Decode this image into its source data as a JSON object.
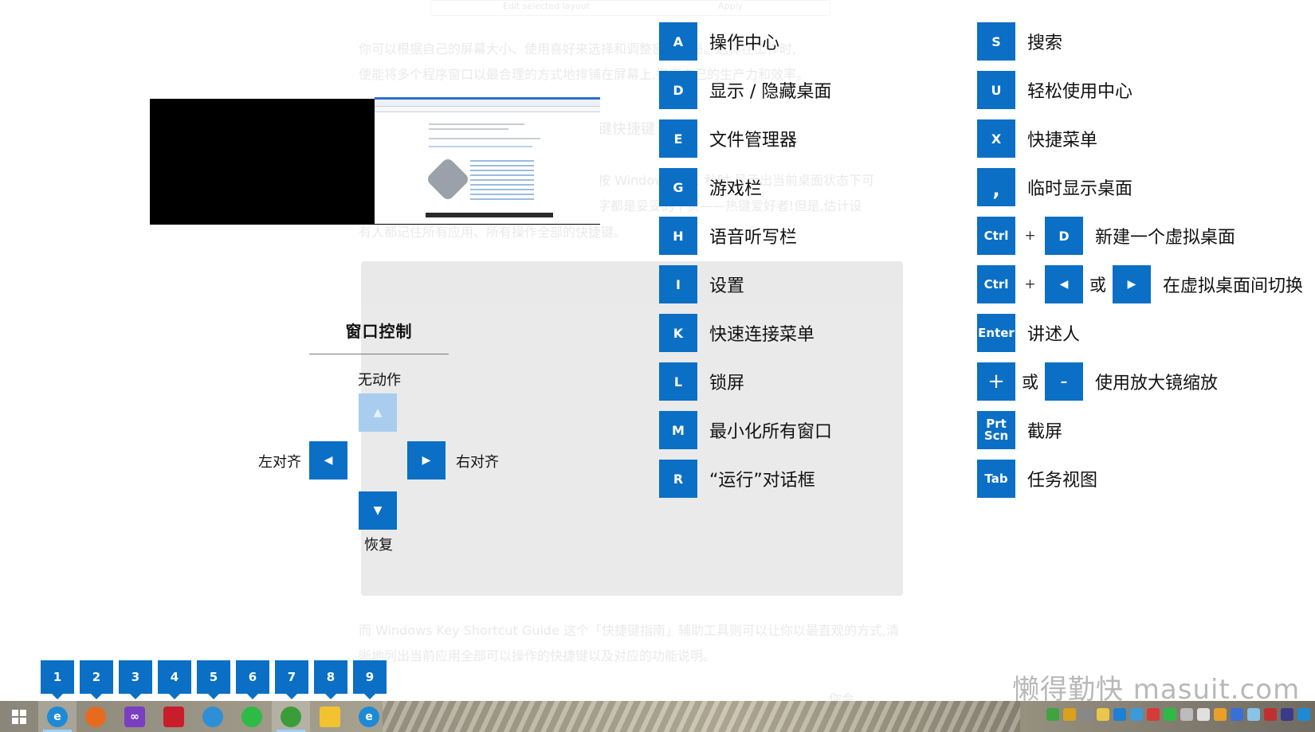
{
  "background_article": {
    "strip_labels": [
      "Edit selected layout",
      "Apply"
    ],
    "lines": [
      "你可以根据自己的屏幕大小、使用喜好来选择和调整窗口布局。这样在工作时,",
      "便能将多个程序窗口以最合理的方式地排铺在屏幕上,提高自己的生产力和效率。",
      "键快捷键",
      "按 Windows 键 1 秒时,显示出当前桌面状态下可",
      "字都是妥妥的干货——热键爱好者!但是,估计设",
      "有人都记住所有应用、所有操作全部的快捷键。",
      "而 Windows Key Shortcut Guide 这个「快捷键指南」辅助工具则可以让你以最直观的方式,清",
      "晰地列出当前应用全部可以操作的快捷键以及对应的功能说明。",
      "你会"
    ]
  },
  "window_controls": {
    "title": "窗口控制",
    "up_label": "无动作",
    "left_label": "左对齐",
    "right_label": "右对齐",
    "down_label": "恢复",
    "up_arrow": "▲",
    "left_arrow": "◀",
    "right_arrow": "▶",
    "down_arrow": "▼"
  },
  "shortcuts_left": [
    {
      "key": "A",
      "desc": "操作中心"
    },
    {
      "key": "D",
      "desc": "显示 / 隐藏桌面"
    },
    {
      "key": "E",
      "desc": "文件管理器"
    },
    {
      "key": "G",
      "desc": "游戏栏"
    },
    {
      "key": "H",
      "desc": "语音听写栏"
    },
    {
      "key": "I",
      "desc": "设置"
    },
    {
      "key": "K",
      "desc": "快速连接菜单"
    },
    {
      "key": "L",
      "desc": "锁屏"
    },
    {
      "key": "M",
      "desc": "最小化所有窗口"
    },
    {
      "key": "R",
      "desc": "“运行”对话框"
    }
  ],
  "shortcuts_right": {
    "s": {
      "key": "S",
      "desc": "搜索"
    },
    "u": {
      "key": "U",
      "desc": "轻松使用中心"
    },
    "x": {
      "key": "X",
      "desc": "快捷菜单"
    },
    "comma": {
      "key": ",",
      "desc": "临时显示桌面"
    },
    "ctrl_d": {
      "key1": "Ctrl",
      "plus": "+",
      "key2": "D",
      "desc": "新建一个虚拟桌面"
    },
    "ctrl_arrows": {
      "key1": "Ctrl",
      "plus": "+",
      "left": "◀",
      "or": "或",
      "right": "▶",
      "desc": "在虚拟桌面间切换"
    },
    "enter": {
      "key": "Enter",
      "desc": "讲述人"
    },
    "zoom": {
      "plus_key": "+",
      "or": "或",
      "minus_key": "-",
      "desc": "使用放大镜缩放"
    },
    "prtscn": {
      "key_line1": "Prt",
      "key_line2": "Scn",
      "desc": "截屏"
    },
    "tab": {
      "key": "Tab",
      "desc": "任务视图"
    }
  },
  "taskbar_numbers": [
    "1",
    "2",
    "3",
    "4",
    "5",
    "6",
    "7",
    "8",
    "9"
  ],
  "taskbar_apps": [
    {
      "name": "start",
      "icon": "windows-logo-icon",
      "color": "#ffffff"
    },
    {
      "name": "edge",
      "icon": "edge-icon",
      "color": "#1e8ad6",
      "active": true
    },
    {
      "name": "firefox",
      "icon": "firefox-icon",
      "color": "#e66b1f"
    },
    {
      "name": "visual-studio",
      "icon": "visual-studio-icon",
      "color": "#7a3fc0"
    },
    {
      "name": "app-red",
      "icon": "red-app-icon",
      "color": "#c81e2a"
    },
    {
      "name": "app-search",
      "icon": "magnifier-app-icon",
      "color": "#2f8fd6"
    },
    {
      "name": "wechat",
      "icon": "wechat-icon",
      "color": "#2dbb45"
    },
    {
      "name": "globe-app",
      "icon": "globe-app-icon",
      "color": "#3a9d3a",
      "active": true
    },
    {
      "name": "file-explorer",
      "icon": "folder-icon",
      "color": "#f2c230"
    },
    {
      "name": "edge-2",
      "icon": "edge-icon",
      "color": "#1e8ad6"
    }
  ],
  "tray_colors": [
    "#3fa33f",
    "#d9a11c",
    "#888888",
    "#e8c74a",
    "#1e7fd6",
    "#3a9bd8",
    "#d63a3a",
    "#2dbb45",
    "#bbbbbb",
    "#e0e0e0",
    "#e8a02a",
    "#3a6fd8",
    "#8bc3e8",
    "#c03030",
    "#3a3a8a",
    "#1e8ad6"
  ],
  "watermark": "懒得勤快 masuit.com"
}
